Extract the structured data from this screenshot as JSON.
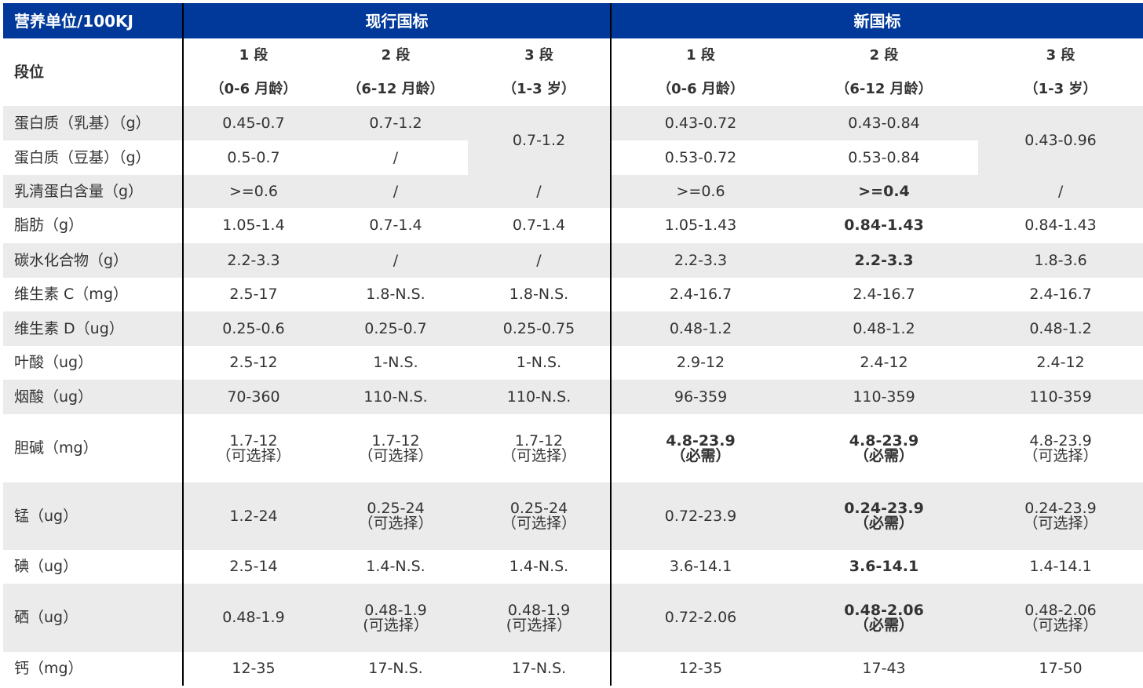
{
  "header": {
    "corner": "营养单位/100KJ",
    "current": "现行国标",
    "new": "新国标"
  },
  "stage_row": {
    "label": "段位",
    "stages": [
      {
        "name": "1 段",
        "age": "（0-6 月龄）"
      },
      {
        "name": "2 段",
        "age": "（6-12 月龄）"
      },
      {
        "name": "3 段",
        "age": "（1-3 岁）"
      },
      {
        "name": "1 段",
        "age": "（0-6 月龄）"
      },
      {
        "name": "2 段",
        "age": "（6-12 月龄）"
      },
      {
        "name": "3 段",
        "age": "（1-3 岁）"
      }
    ]
  },
  "rows": {
    "protein_milk": {
      "label": "蛋白质（乳基）（g）",
      "c1": "0.45-0.7",
      "c2": "0.7-1.2",
      "c3": "0.7-1.2",
      "n1": "0.43-0.72",
      "n2": "0.43-0.84",
      "n3": "0.43-0.96"
    },
    "protein_soy": {
      "label": "蛋白质（豆基）（g）",
      "c1": "0.5-0.7",
      "c2": "/",
      "n1": "0.53-0.72",
      "n2": "0.53-0.84"
    },
    "whey": {
      "label": "乳清蛋白含量（g）",
      "c1": ">=0.6",
      "c2": "/",
      "c3": "/",
      "n1": ">=0.6",
      "n2": ">=0.4",
      "n3": "/"
    },
    "fat": {
      "label": "脂肪（g）",
      "c1": "1.05-1.4",
      "c2": "0.7-1.4",
      "c3": "0.7-1.4",
      "n1": "1.05-1.43",
      "n2": "0.84-1.43",
      "n3": "0.84-1.43"
    },
    "carb": {
      "label": "碳水化合物（g）",
      "c1": "2.2-3.3",
      "c2": "/",
      "c3": "/",
      "n1": "2.2-3.3",
      "n2": "2.2-3.3",
      "n3": "1.8-3.6"
    },
    "vit_c": {
      "label": "维生素 C（mg）",
      "c1": "2.5-17",
      "c2": "1.8-N.S.",
      "c3": "1.8-N.S.",
      "n1": "2.4-16.7",
      "n2": "2.4-16.7",
      "n3": "2.4-16.7"
    },
    "vit_d": {
      "label": "维生素 D（ug）",
      "c1": "0.25-0.6",
      "c2": "0.25-0.7",
      "c3": "0.25-0.75",
      "n1": "0.48-1.2",
      "n2": "0.48-1.2",
      "n3": "0.48-1.2"
    },
    "folic": {
      "label": "叶酸（ug）",
      "c1": "2.5-12",
      "c2": "1-N.S.",
      "c3": "1-N.S.",
      "n1": "2.9-12",
      "n2": "2.4-12",
      "n3": "2.4-12"
    },
    "niacin": {
      "label": "烟酸（ug）",
      "c1": "70-360",
      "c2": "110-N.S.",
      "c3": "110-N.S.",
      "n1": "96-359",
      "n2": "110-359",
      "n3": "110-359"
    },
    "choline": {
      "label": "胆碱（mg）",
      "c1": "1.7-12",
      "c1_note": "（可选择）",
      "c2": "1.7-12",
      "c2_note": "（可选择）",
      "c3": "1.7-12",
      "c3_note": "（可选择）",
      "n1": "4.8-23.9",
      "n1_note": "（必需）",
      "n2": "4.8-23.9",
      "n2_note": "（必需）",
      "n3": "4.8-23.9",
      "n3_note": "（可选择）"
    },
    "manganese": {
      "label": "锰（ug）",
      "c1": "1.2-24",
      "c2": "0.25-24",
      "c2_note": "（可选择）",
      "c3": "0.25-24",
      "c3_note": "（可选择）",
      "n1": "0.72-23.9",
      "n2": "0.24-23.9",
      "n2_note": "（必需）",
      "n3": "0.24-23.9",
      "n3_note": "（可选择）"
    },
    "iodine": {
      "label": "碘（ug）",
      "c1": "2.5-14",
      "c2": "1.4-N.S.",
      "c3": "1.4-N.S.",
      "n1": "3.6-14.1",
      "n2": "3.6-14.1",
      "n3": "1.4-14.1"
    },
    "selenium": {
      "label": "硒（ug）",
      "c1": "0.48-1.9",
      "c2": "0.48-1.9",
      "c2_note": "(可选择）",
      "c3": "0.48-1.9",
      "c3_note": "(可选择）",
      "n1": "0.72-2.06",
      "n2": "0.48-2.06",
      "n2_note": "（必需）",
      "n3": "0.48-2.06",
      "n3_note": "（可选择）"
    },
    "calcium": {
      "label": "钙（mg）",
      "c1": "12-35",
      "c2": "17-N.S.",
      "c3": "17-N.S.",
      "n1": "12-35",
      "n2": "17-43",
      "n3": "17-50"
    }
  },
  "colors": {
    "header_bg": "#00399a",
    "header_text": "#ffffff",
    "stripe": "#ebebeb",
    "divider": "#000000"
  }
}
